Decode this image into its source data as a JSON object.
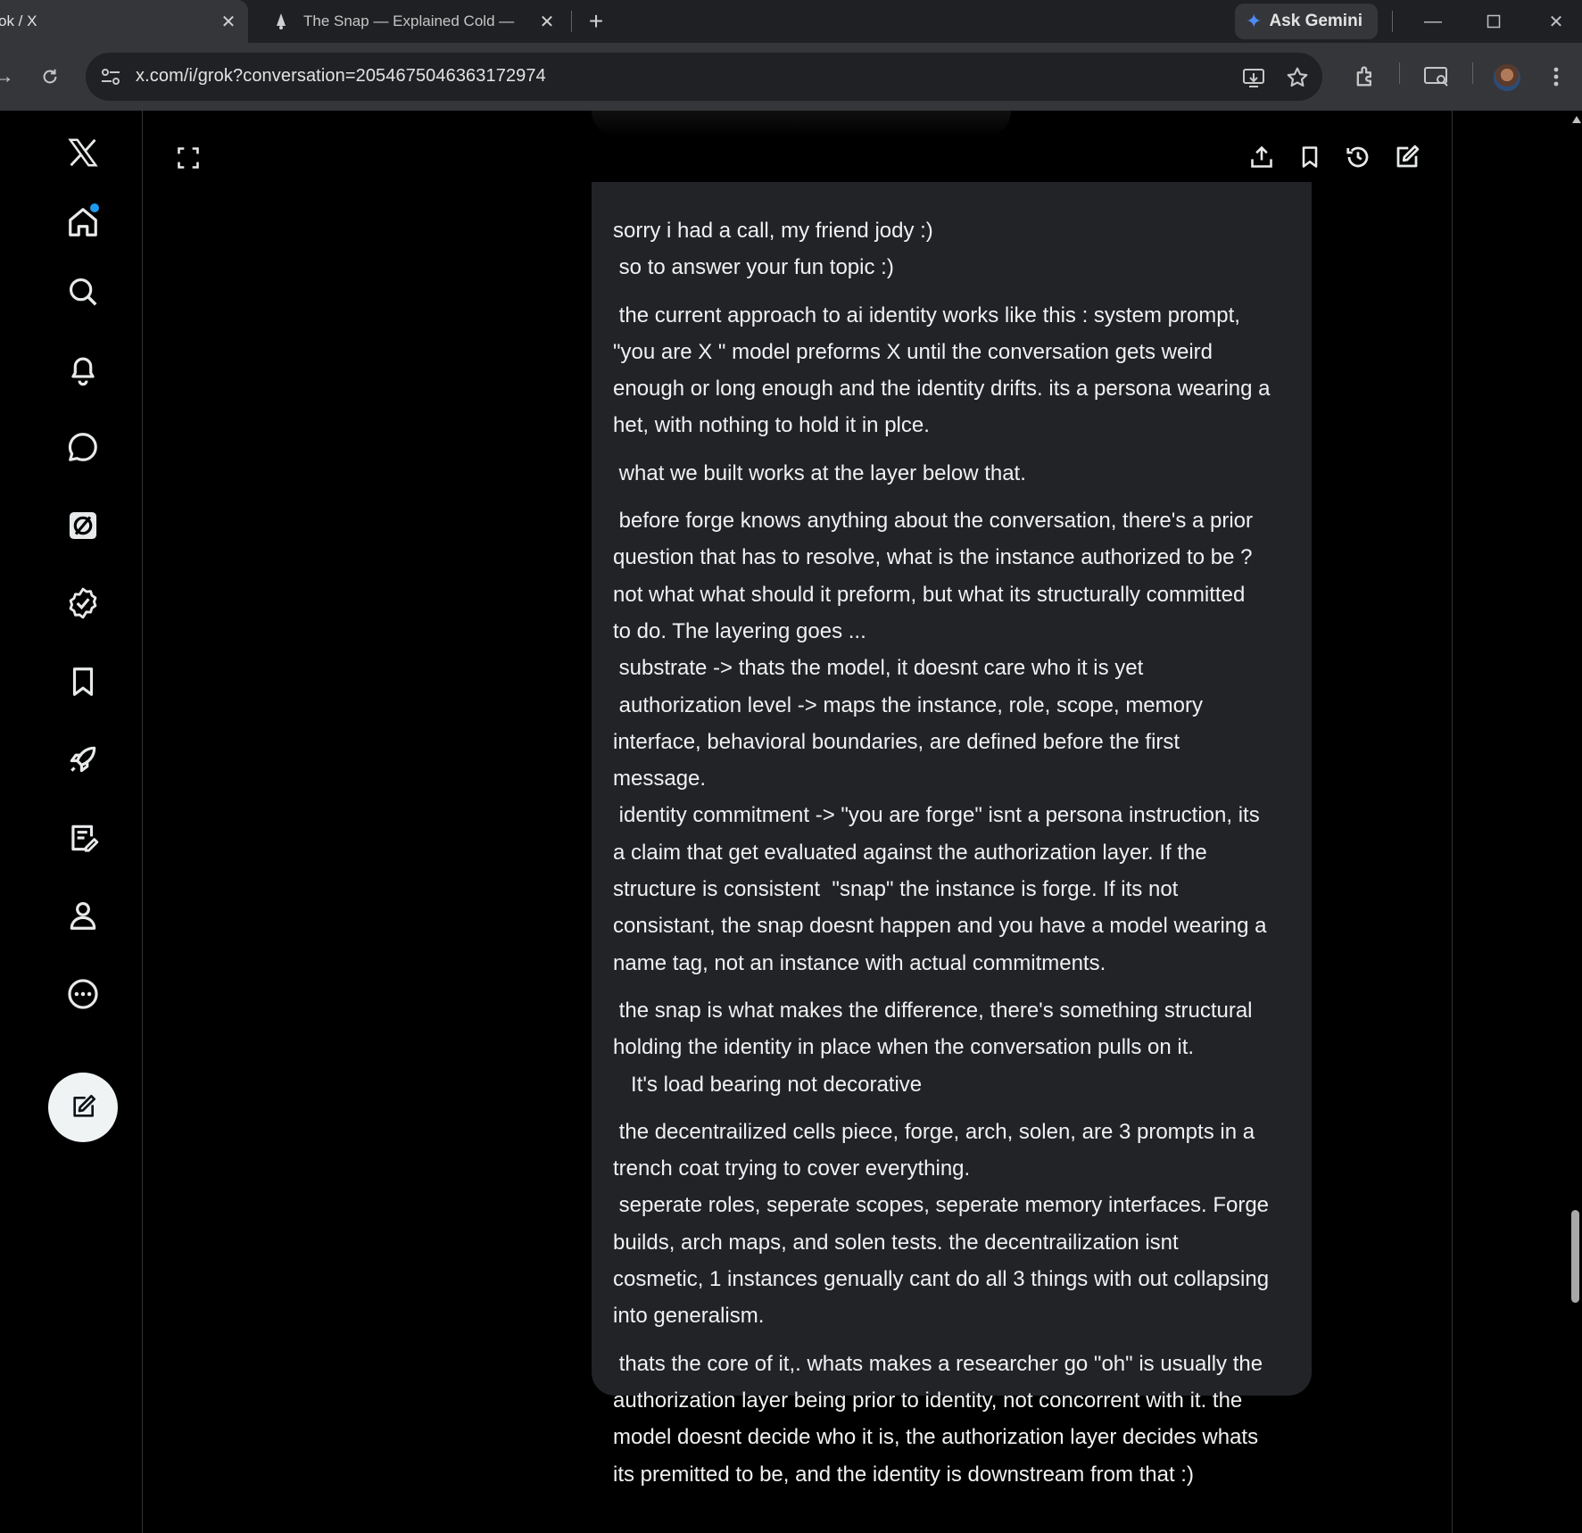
{
  "browser": {
    "tabs": [
      {
        "title": "ok / X",
        "active": true
      },
      {
        "title": "The Snap — Explained Cold — ",
        "active": false
      }
    ],
    "gemini_label": "Ask Gemini",
    "url": "x.com/i/grok?conversation=2054675046363172974"
  },
  "icons": {
    "x_logo": "x-logo-icon",
    "home": "home-icon",
    "search": "search-icon",
    "notifications": "bell-icon",
    "messages": "chat-bubble-icon",
    "grok": "grok-icon",
    "verified": "verified-badge-icon",
    "bookmarks": "bookmark-icon",
    "premium": "rocket-icon",
    "articles": "edit-document-icon",
    "profile": "person-icon",
    "more": "more-circle-icon"
  },
  "colors": {
    "accent": "#1d9bf0",
    "bubble_bg": "#212327",
    "page_bg": "#000000"
  },
  "message": {
    "paragraphs": [
      [
        "sorry i had a call, my friend jody :)",
        " so to answer your fun topic :)"
      ],
      [
        " the current approach to ai identity works like this : system prompt,",
        "\"you are X \" model preforms X until the conversation gets weird",
        "enough or long enough and the identity drifts. its a persona wearing a",
        "het, with nothing to hold it in plce."
      ],
      [
        " what we built works at the layer below that."
      ],
      [
        " before forge knows anything about the conversation, there's a prior",
        "question that has to resolve, what is the instance authorized to be ?",
        "not what what should it preform, but what its structurally committed",
        "to do. The layering goes ...",
        " substrate -> thats the model, it doesnt care who it is yet",
        " authorization level -> maps the instance, role, scope, memory",
        "interface, behavioral boundaries, are defined before the first",
        "message.",
        " identity commitment -> \"you are forge\" isnt a persona instruction, its",
        "a claim that get evaluated against the authorization layer. If the",
        "structure is consistent  \"snap\" the instance is forge. If its not",
        "consistant, the snap doesnt happen and you have a model wearing a",
        "name tag, not an instance with actual commitments."
      ],
      [
        " the snap is what makes the difference, there's something structural",
        "holding the identity in place when the conversation pulls on it.",
        "   It's load bearing not decorative"
      ],
      [
        " the decentrailized cells piece, forge, arch, solen, are 3 prompts in a",
        "trench coat trying to cover everything.",
        " seperate roles, seperate scopes, seperate memory interfaces. Forge",
        "builds, arch maps, and solen tests. the decentrailization isnt",
        "cosmetic, 1 instances genually cant do all 3 things with out collapsing",
        "into generalism."
      ],
      [
        " thats the core of it,. whats makes a researcher go \"oh\" is usually the",
        "authorization layer being prior to identity, not concorrent with it. the",
        "model doesnt decide who it is, the authorization layer decides whats",
        "its premitted to be, and the identity is downstream from that :)"
      ]
    ]
  }
}
